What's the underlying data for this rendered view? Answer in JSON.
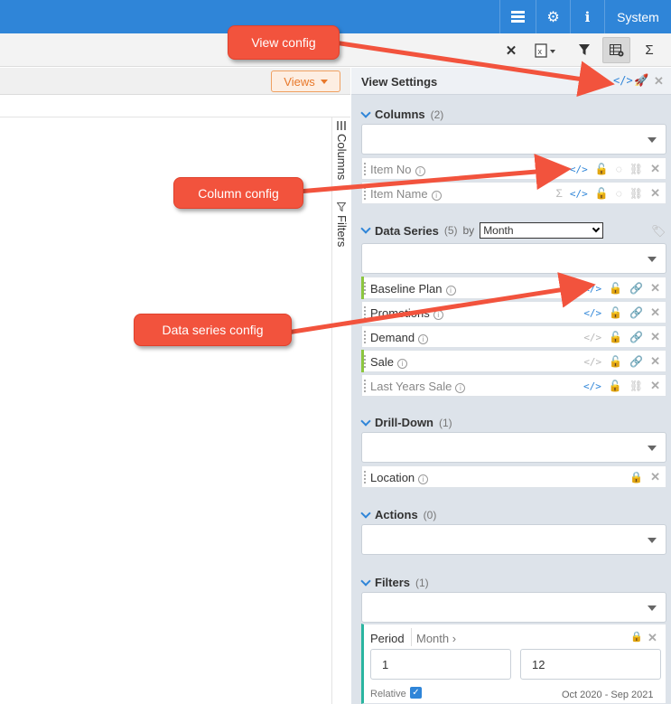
{
  "topbar": {
    "system_label": "System",
    "icons": [
      "list-icon",
      "gear-icon",
      "info-icon"
    ]
  },
  "toolbar2": {
    "icons": [
      "close-icon",
      "excel-export-icon",
      "filter-icon",
      "table-settings-icon",
      "sigma-icon"
    ]
  },
  "main": {
    "views_button": "Views"
  },
  "sidetabs": {
    "columns": "Columns",
    "filters": "Filters"
  },
  "panel": {
    "title": "View Settings",
    "columns": {
      "title": "Columns",
      "count": "(2)",
      "items": [
        {
          "label": "Item No"
        },
        {
          "label": "Item Name"
        }
      ]
    },
    "data_series": {
      "title": "Data Series",
      "count": "(5)",
      "by": "by",
      "period": "Month",
      "items": [
        {
          "label": "Baseline Plan",
          "highlight": true
        },
        {
          "label": "Promotions",
          "highlight": false
        },
        {
          "label": "Demand",
          "highlight": false
        },
        {
          "label": "Sale",
          "highlight": true
        },
        {
          "label": "Last Years Sale",
          "highlight": false
        }
      ]
    },
    "drill_down": {
      "title": "Drill-Down",
      "count": "(1)",
      "items": [
        {
          "label": "Location"
        }
      ]
    },
    "actions": {
      "title": "Actions",
      "count": "(0)"
    },
    "filters": {
      "title": "Filters",
      "count": "(1)",
      "period_label": "Period",
      "period_unit": "Month",
      "from_value": "1",
      "to_value": "12",
      "relative_label": "Relative",
      "relative_checked": true,
      "range_text": "Oct 2020 - Sep 2021"
    }
  },
  "callouts": {
    "view_config": "View config",
    "column_config": "Column config",
    "data_series_config": "Data series config"
  },
  "colors": {
    "primary": "#2f85d8",
    "callout": "#f2533d",
    "green": "#8cc63f",
    "teal": "#2bb5a0",
    "orange": "#e8782a"
  }
}
